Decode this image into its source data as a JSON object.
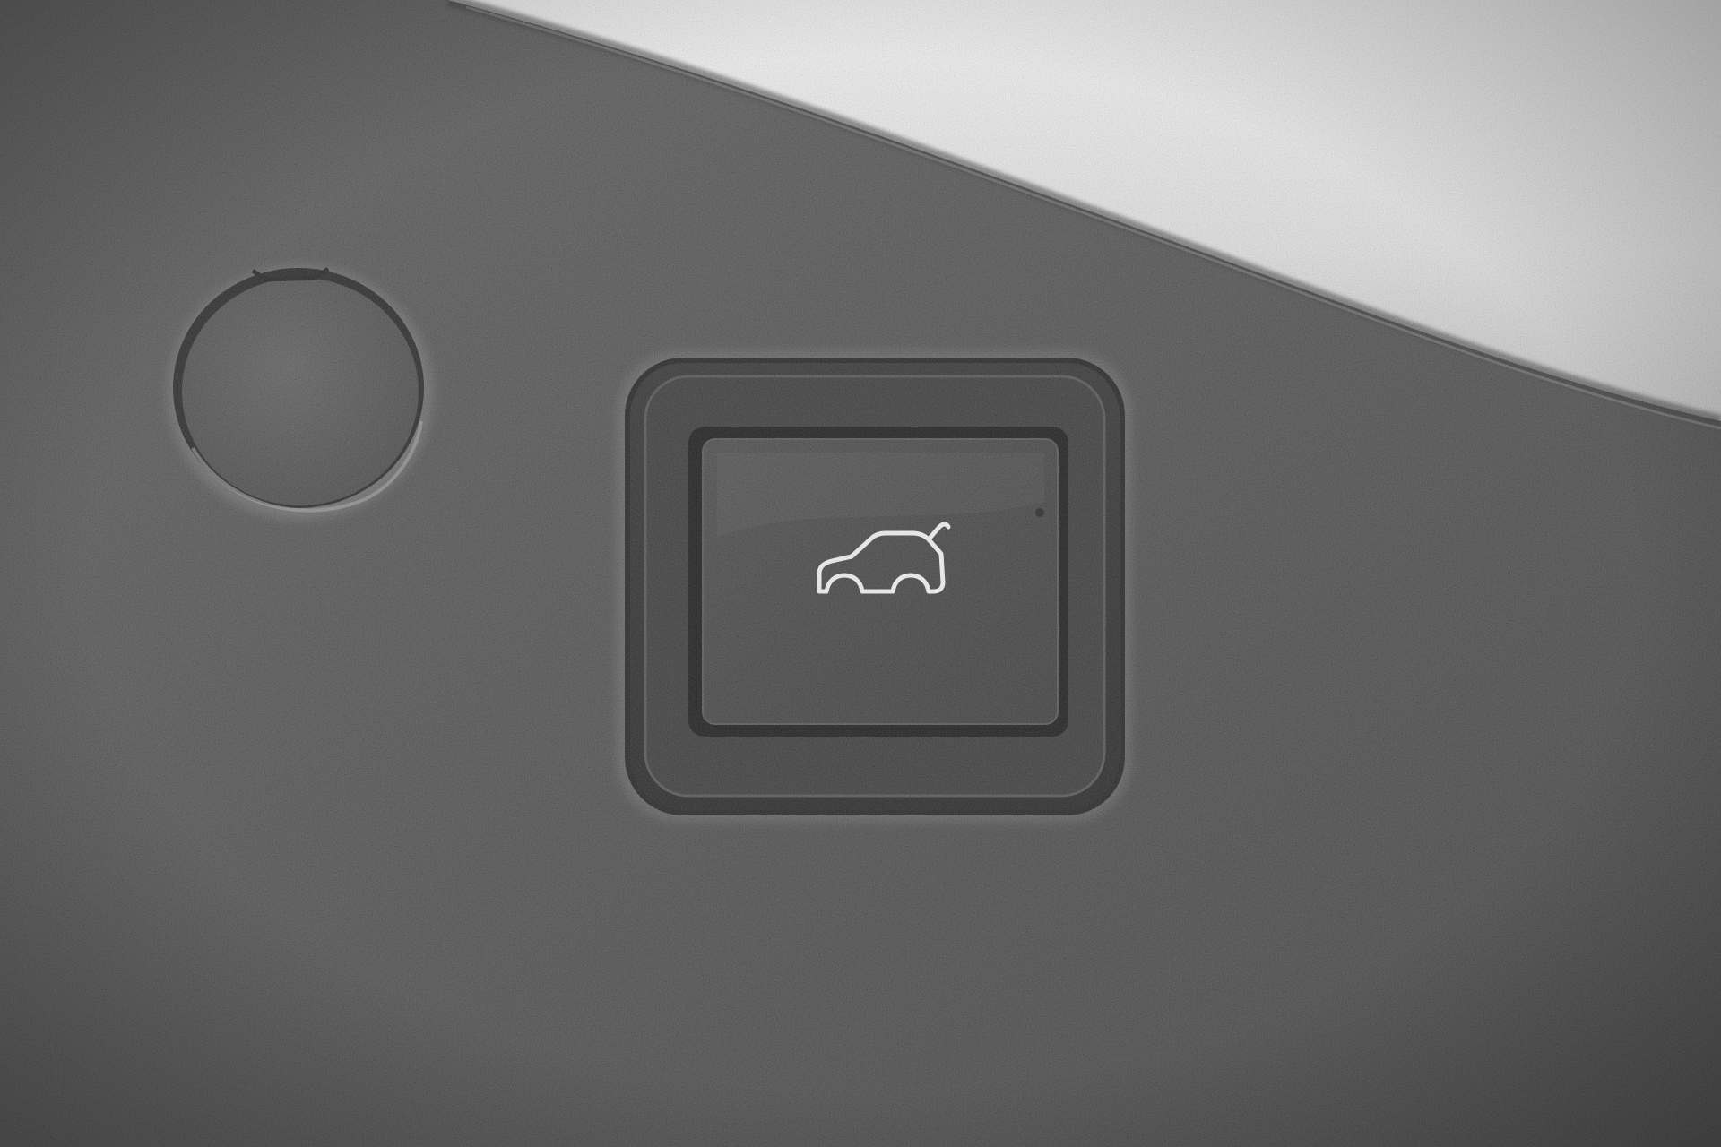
{
  "scene": {
    "subject": "tailgate-close-button",
    "panel_color": "#4a4a4a",
    "trim_color": "#e2e2e2",
    "button_color": "#3d3d3d",
    "symbol_color": "#f2f2f2",
    "icons": [
      "tailgate-close-icon"
    ]
  }
}
